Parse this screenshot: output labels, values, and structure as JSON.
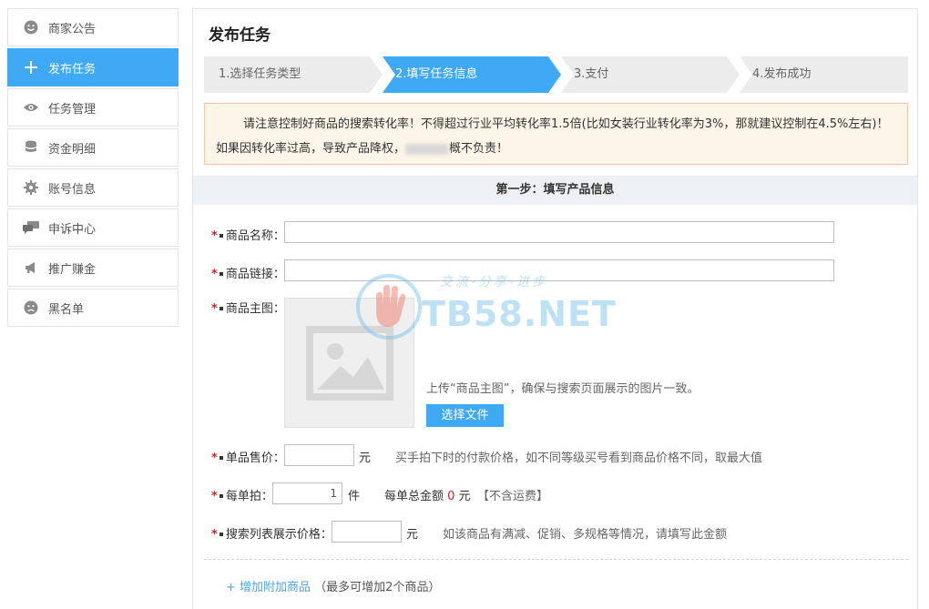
{
  "sidebar": {
    "items": [
      {
        "label": "商家公告",
        "icon": "smiley-icon"
      },
      {
        "label": "发布任务",
        "icon": "plus-icon",
        "active": true
      },
      {
        "label": "任务管理",
        "icon": "eye-icon"
      },
      {
        "label": "资金明细",
        "icon": "database-icon"
      },
      {
        "label": "账号信息",
        "icon": "gear-icon"
      },
      {
        "label": "申诉中心",
        "icon": "chat-icon"
      },
      {
        "label": "推广赚金",
        "icon": "megaphone-icon"
      },
      {
        "label": "黑名单",
        "icon": "sad-face-icon"
      }
    ]
  },
  "main": {
    "title": "发布任务",
    "steps": [
      {
        "label": "1.选择任务类型"
      },
      {
        "label": "2.填写任务信息",
        "active": true
      },
      {
        "label": "3.支付"
      },
      {
        "label": "4.发布成功"
      }
    ],
    "notice": {
      "part1": "请注意控制好商品的搜索转化率！不得超过行业平均转化率1.5倍(比如女装行业转化率为3%，那就建议控制在4.5%左右)！如果因转化率过高，导致产品降权，",
      "part2": "概不负责！"
    },
    "section_title": "第一步：填写产品信息",
    "form": {
      "required_mark": "*",
      "product_name": {
        "label": "商品名称：",
        "value": ""
      },
      "product_link": {
        "label": "商品链接：",
        "value": ""
      },
      "main_image": {
        "label": "商品主图：",
        "hint": "上传“商品主图”，确保与搜索页面展示的图片一致。",
        "button": "选择文件"
      },
      "unit_price": {
        "label": "单品售价：",
        "value": "",
        "unit": "元",
        "hint": "买手拍下时的付款价格，如不同等级买号看到商品价格不同，取最大值"
      },
      "per_order": {
        "label": "每单拍：",
        "value": "1",
        "unit": "件",
        "total_label": "每单总金额",
        "total_value": "0",
        "total_unit": "元",
        "shipping_note": "【不含运费】"
      },
      "search_price": {
        "label": "搜索列表展示价格：",
        "value": "",
        "unit": "元",
        "hint": "如该商品有满减、促销、多规格等情况，请填写此金额"
      }
    },
    "add_product": {
      "link": "+ 增加附加商品",
      "note": "（最多可增加2个商品）"
    }
  },
  "watermark": {
    "slogan": "交流-分享-进步",
    "text": "TB58.NET"
  },
  "colors": {
    "accent": "#3fa9f5",
    "required": "#e02020",
    "notice_bg": "#fdf6e8",
    "notice_border": "#f2c6a8"
  }
}
